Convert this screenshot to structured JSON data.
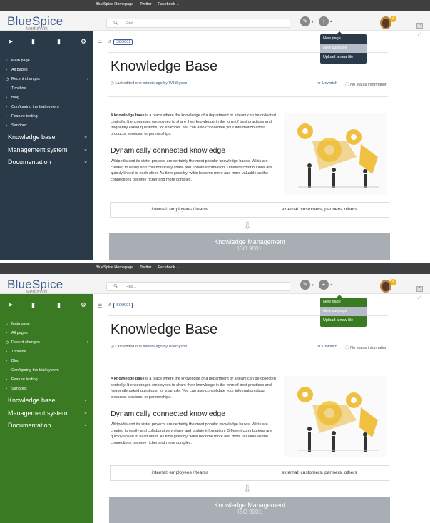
{
  "topbar": {
    "links": [
      "BlueSpice Homepage",
      "Twitter",
      "Facebook ⌄"
    ]
  },
  "logo": {
    "name": "BlueSpice",
    "sub": "MediaWiki"
  },
  "search": {
    "placeholder": "Find..."
  },
  "avatar_badge": "4",
  "dropdown": {
    "items": [
      "New page",
      "New subpage",
      "Upload a new file"
    ],
    "selected": 1
  },
  "sidebar": {
    "nav": [
      "Main page",
      "All pages",
      "Recent changes",
      "Timeline",
      "Blog",
      "Configuring the trial system",
      "Feature testing",
      "Sandbox"
    ],
    "sections": [
      "Knowledge base",
      "Management system",
      "Documentation"
    ]
  },
  "breadcrumb": {
    "tag": "ISO9001"
  },
  "page": {
    "title": "Knowledge Base",
    "last_edited_prefix": "Last edited",
    "last_edited_time": "one minute ago",
    "last_edited_by": "by",
    "last_edited_user": "WikiSysop",
    "unwatch": "Unwatch",
    "status": "No status information",
    "para1_pre": "A ",
    "para1_bold": "knowledge base",
    "para1_post": " is a place where the knowledge of a department or a team can be collected centrally. It encourages employees to share their knowledge in the form of best practices and frequently asked questions, for example. You can also consolidate your information about products, services, or partnerships.",
    "heading2": "Dynamically connected knowledge",
    "para2": "Wikipedia and its sister projects are certainly the most popular knowledge bases. Wikis are created to easily and collaboratively share and update information. Different contributions are quickly linked to each other. As time goes by, wikis become more and more valuable as the connections become richer and more complex.",
    "table_internal": "internal: employees / teams",
    "table_external": "external: customers, partners, others",
    "km_title": "Knowledge Management",
    "km_sub": "ISO 9001"
  },
  "variants": [
    {
      "sidebar_color": "#2b3a48",
      "dropdown_color": "#2b3a48"
    },
    {
      "sidebar_color": "#3a7a23",
      "dropdown_color": "#3a7a23"
    }
  ]
}
